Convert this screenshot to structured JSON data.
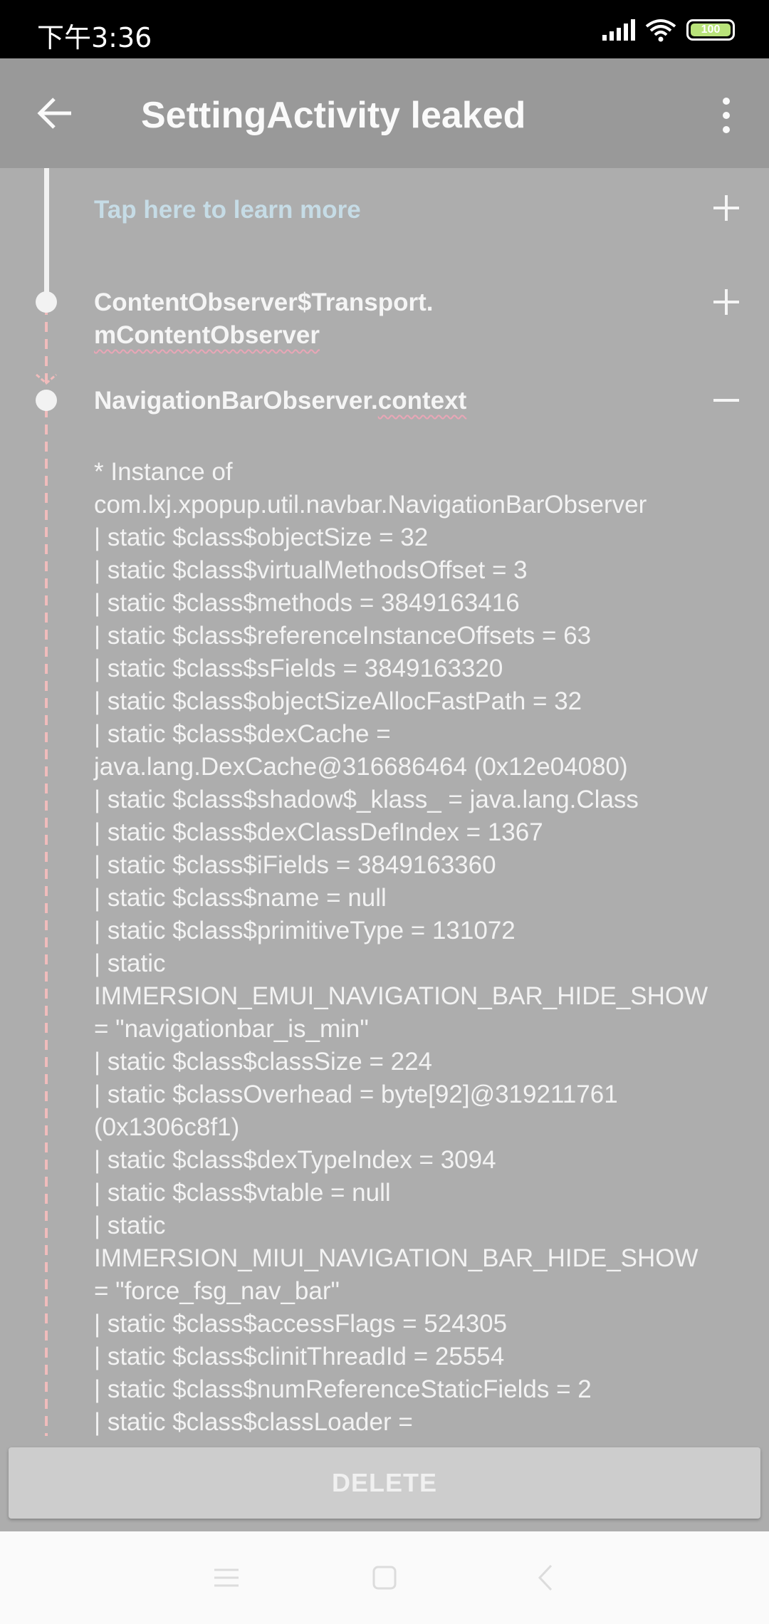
{
  "status_bar": {
    "time": "下午3:36",
    "battery": "100"
  },
  "app_bar": {
    "title": "SettingActivity leaked"
  },
  "trace": {
    "learn_more": "Tap here to learn more",
    "node1": {
      "class": "ContentObserver$Transport.",
      "field": "mContentObserver"
    },
    "node2": {
      "class": "NavigationBarObserver.",
      "field": "context"
    },
    "details_lines": [
      "* Instance of",
      "com.lxj.xpopup.util.navbar.NavigationBarObserver",
      "| static $class$objectSize = 32",
      "| static $class$virtualMethodsOffset = 3",
      "| static $class$methods = 3849163416",
      "| static $class$referenceInstanceOffsets = 63",
      "| static $class$sFields = 3849163320",
      "| static $class$objectSizeAllocFastPath = 32",
      "| static $class$dexCache =",
      "java.lang.DexCache@316686464 (0x12e04080)",
      "| static $class$shadow$_klass_ = java.lang.Class",
      "| static $class$dexClassDefIndex = 1367",
      "| static $class$iFields = 3849163360",
      "| static $class$name = null",
      "| static $class$primitiveType = 131072",
      "| static",
      "IMMERSION_EMUI_NAVIGATION_BAR_HIDE_SHOW",
      "= \"navigationbar_is_min\"",
      "| static $class$classSize = 224",
      "| static $classOverhead = byte[92]@319211761",
      "(0x1306c8f1)",
      "| static $class$dexTypeIndex = 3094",
      "| static $class$vtable = null",
      "| static",
      "IMMERSION_MIUI_NAVIGATION_BAR_HIDE_SHOW",
      "= \"force_fsg_nav_bar\"",
      "| static $class$accessFlags = 524305",
      "| static $class$clinitThreadId = 25554",
      "| static $class$numReferenceStaticFields = 2",
      "| static $class$classLoader ="
    ]
  },
  "delete_label": "DELETE",
  "colors": {
    "app_bar": "#999999",
    "background": "#adadad",
    "learn_more": "#c6dce6",
    "dashed_line": "#f0bcbc"
  }
}
